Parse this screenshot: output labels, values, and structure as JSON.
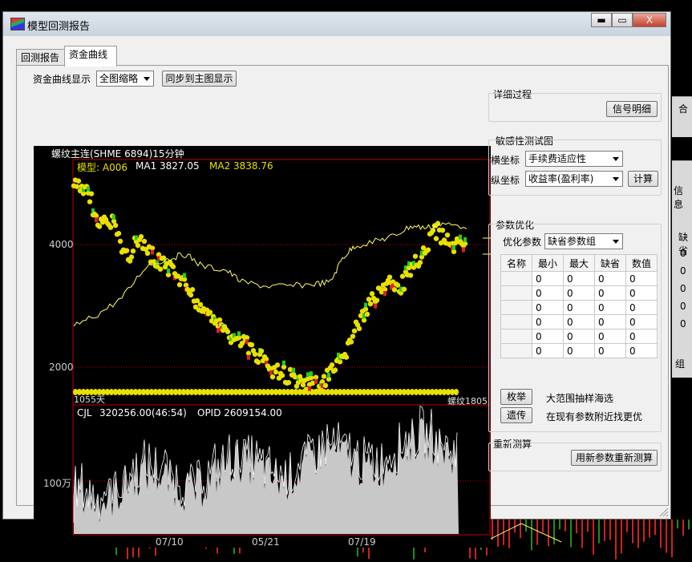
{
  "window": {
    "title": "模型回测报告",
    "minimize": "▬",
    "maximize": "▭",
    "close": "X"
  },
  "tabs": [
    {
      "label": "回测报告",
      "active": false
    },
    {
      "label": "资金曲线",
      "active": true
    }
  ],
  "toolbar": {
    "display_label": "资金曲线显示",
    "display_value": "全图缩略",
    "sync_button": "同步到主图显示"
  },
  "chart": {
    "symbol_title": "螺纹主连(SHME 6894)15分钟",
    "model_label": "模型: A006",
    "ma1_label": "MA1 3827.05",
    "ma2_label": "MA2 3838.76",
    "y_labels": [
      "4000",
      "2000"
    ],
    "left_scroll_text": "1055天",
    "right_scroll_text": "螺纹1805",
    "volume_label": "CJL",
    "volume_value": "320256.00(46:54)",
    "opid_label": "OPID 2609154.00",
    "volume_y_label": "100万",
    "x_labels": [
      "07/10",
      "05/21",
      "07/19"
    ],
    "colors": {
      "price_dots": "#e8e000",
      "up": "#22cc22",
      "down": "#dd2222",
      "line": "#ffff66",
      "volume": "#c8c8c8",
      "vol_line": "#ffffff",
      "axis": "#c00000"
    }
  },
  "right_panel": {
    "detail": {
      "title": "详细过程",
      "signal_button": "信号明细"
    },
    "sensitivity": {
      "title": "敏感性测试图",
      "x_label": "横坐标",
      "x_value": "手续费适应性",
      "y_label": "纵坐标",
      "y_value": "收益率(盈利率)",
      "calc_button": "计算"
    },
    "params": {
      "title": "参数优化",
      "opt_label": "优化参数",
      "opt_value": "缺省参数组",
      "columns": [
        "名称",
        "最小",
        "最大",
        "缺省",
        "数值"
      ],
      "rows": [
        [
          "",
          "0",
          "0",
          "0",
          "0"
        ],
        [
          "",
          "0",
          "0",
          "0",
          "0"
        ],
        [
          "",
          "0",
          "0",
          "0",
          "0"
        ],
        [
          "",
          "0",
          "0",
          "0",
          "0"
        ],
        [
          "",
          "0",
          "0",
          "0",
          "0"
        ],
        [
          "",
          "0",
          "0",
          "0",
          "0"
        ]
      ],
      "exhaustive_button": "枚举",
      "exhaustive_desc": "大范围抽样海选",
      "genetic_button": "遗传",
      "genetic_desc": "在现有参数附近找更优"
    },
    "recalc": {
      "title": "重新测算",
      "button": "用新参数重新测算"
    }
  },
  "background_right": {
    "labels": [
      "合",
      "信息",
      "缺省",
      "0",
      "0",
      "0",
      "0",
      "0",
      "组"
    ]
  }
}
